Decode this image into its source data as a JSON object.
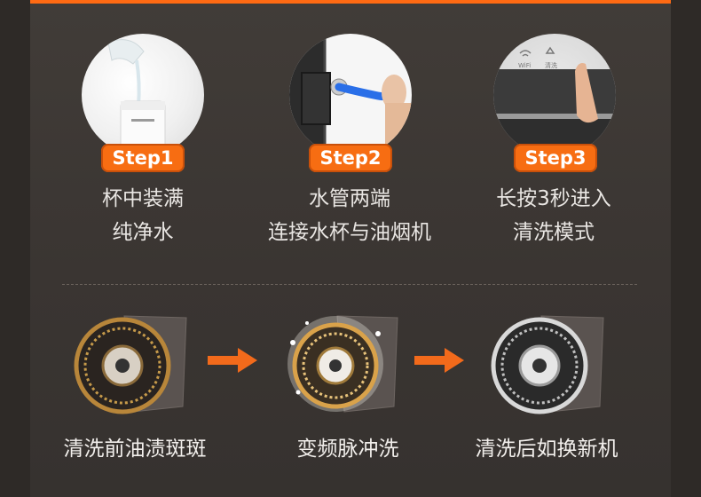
{
  "steps": [
    {
      "badge": "Step1",
      "line1": "杯中装满",
      "line2": "纯净水"
    },
    {
      "badge": "Step2",
      "line1": "水管两端",
      "line2": "连接水杯与油烟机"
    },
    {
      "badge": "Step3",
      "line1": "长按3秒进入",
      "line2": "清洗模式"
    }
  ],
  "panel_text": {
    "wifi": "WiFi",
    "clean": "清洗"
  },
  "stages": [
    {
      "caption": "清洗前油渍斑斑"
    },
    {
      "caption": "变频脉冲洗"
    },
    {
      "caption": "清洗后如换新机"
    }
  ],
  "colors": {
    "accent": "#f76d12",
    "background": "#3a3532",
    "text": "#e9e6e3"
  },
  "icons": [
    "right-arrow-icon",
    "right-arrow-icon"
  ]
}
